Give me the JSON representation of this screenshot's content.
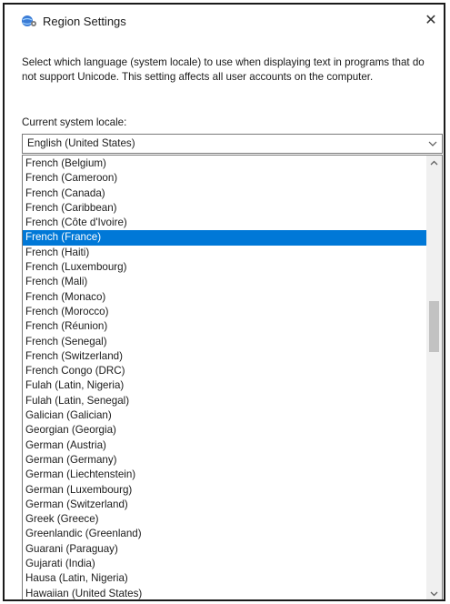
{
  "window": {
    "title": "Region Settings",
    "close_glyph": "✕",
    "icon": "globe-settings-icon"
  },
  "description": "Select which language (system locale) to use when displaying text in programs that do not support Unicode. This setting affects all user accounts on the computer.",
  "locale_label": "Current system locale:",
  "combo": {
    "value": "English (United States)",
    "icon": "chevron-down-icon"
  },
  "list": {
    "items": [
      "French (Belgium)",
      "French (Cameroon)",
      "French (Canada)",
      "French (Caribbean)",
      "French (Côte d'Ivoire)",
      "French (France)",
      "French (Haiti)",
      "French (Luxembourg)",
      "French (Mali)",
      "French (Monaco)",
      "French (Morocco)",
      "French (Réunion)",
      "French (Senegal)",
      "French (Switzerland)",
      "French Congo (DRC)",
      "Fulah (Latin, Nigeria)",
      "Fulah (Latin, Senegal)",
      "Galician (Galician)",
      "Georgian (Georgia)",
      "German (Austria)",
      "German (Germany)",
      "German (Liechtenstein)",
      "German (Luxembourg)",
      "German (Switzerland)",
      "Greek (Greece)",
      "Greenlandic (Greenland)",
      "Guarani (Paraguay)",
      "Gujarati (India)",
      "Hausa (Latin, Nigeria)",
      "Hawaiian (United States)"
    ],
    "selected_index": 5,
    "selection_color": "#0078d7"
  },
  "scrollbar": {
    "up_icon": "scroll-up-arrow-icon",
    "down_icon": "scroll-down-arrow-icon"
  }
}
